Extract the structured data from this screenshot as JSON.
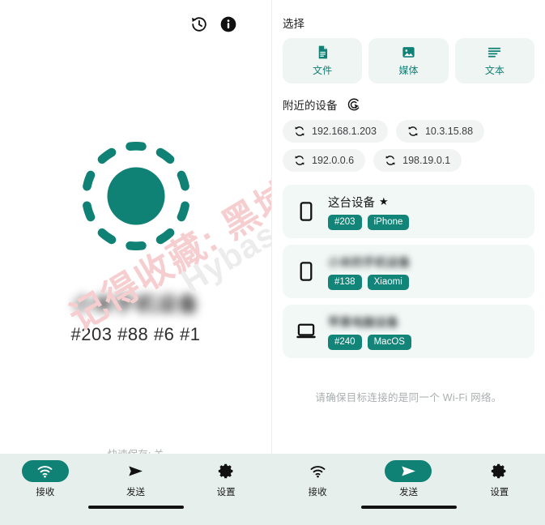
{
  "theme": {
    "accent": "#0F8175",
    "accent_badge": "#128478",
    "nav_bg": "#E6EFEB",
    "card_bg": "#F2F8F6",
    "chip_bg": "#F2F4F4",
    "choose_bg": "#EEF5F3",
    "page_bg": "#FFFFFF"
  },
  "watermark": {
    "line1": "记得收藏: 黑域基地",
    "line2": "Hybase.com"
  },
  "left": {
    "topbar": {
      "history_icon": "history-icon",
      "info_icon": "info-icon"
    },
    "receiver": {
      "icon": "receiving-radar-icon",
      "device_name": "小米手机设备",
      "device_ids": "#203 #88 #6 #1"
    },
    "quick_save": "快速保存: 关",
    "nav": {
      "active": "接收",
      "items": [
        {
          "label": "接收",
          "icon": "wifi-icon",
          "active": true
        },
        {
          "label": "发送",
          "icon": "send-icon",
          "active": false
        },
        {
          "label": "设置",
          "icon": "gear-icon",
          "active": false
        }
      ]
    }
  },
  "right": {
    "choose": {
      "title": "选择",
      "options": [
        {
          "label": "文件",
          "icon": "file-icon"
        },
        {
          "label": "媒体",
          "icon": "image-icon"
        },
        {
          "label": "文本",
          "icon": "text-lines-icon"
        }
      ]
    },
    "nearby": {
      "title": "附近的设备",
      "scan_icon": "radar-scan-icon",
      "ips": [
        {
          "address": "192.168.1.203",
          "icon": "refresh-icon"
        },
        {
          "address": "10.3.15.88",
          "icon": "refresh-icon"
        },
        {
          "address": "192.0.0.6",
          "icon": "refresh-icon"
        },
        {
          "address": "198.19.0.1",
          "icon": "refresh-icon"
        }
      ],
      "devices": [
        {
          "name": "这台设备",
          "starred": true,
          "star": "★",
          "blurred": false,
          "icon": "phone-icon",
          "badges": [
            "#203",
            "iPhone"
          ]
        },
        {
          "name": "小米的手机设备",
          "starred": false,
          "star": "",
          "blurred": true,
          "icon": "phone-icon",
          "badges": [
            "#138",
            "Xiaomi"
          ]
        },
        {
          "name": "苹果电脑设备",
          "starred": false,
          "star": "",
          "blurred": true,
          "icon": "laptop-icon",
          "badges": [
            "#240",
            "MacOS"
          ]
        }
      ]
    },
    "hint": "请确保目标连接的是同一个 Wi-Fi 网络。",
    "nav": {
      "active": "发送",
      "items": [
        {
          "label": "接收",
          "icon": "wifi-icon",
          "active": false
        },
        {
          "label": "发送",
          "icon": "send-icon",
          "active": true
        },
        {
          "label": "设置",
          "icon": "gear-icon",
          "active": false
        }
      ]
    }
  }
}
